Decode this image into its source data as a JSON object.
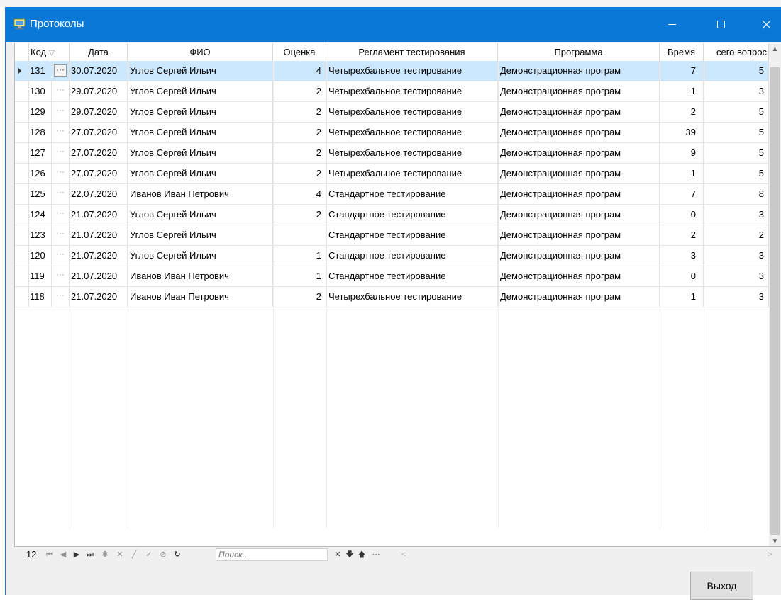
{
  "window": {
    "title": "Протоколы"
  },
  "columns": {
    "kod": "Код",
    "date": "Дата",
    "fio": "ФИО",
    "grade": "Оценка",
    "reglament": "Регламент тестирования",
    "program": "Программа",
    "time": "Время",
    "total": "сего вопрос"
  },
  "rows": [
    {
      "kod": "131",
      "date": "30.07.2020",
      "fio": "Углов Сергей Ильич",
      "grade": "4",
      "reglament": "Четырехбальное тестирование",
      "program": "Демонстрационная програм",
      "time": "7",
      "total": "5",
      "selected": true
    },
    {
      "kod": "130",
      "date": "29.07.2020",
      "fio": "Углов Сергей Ильич",
      "grade": "2",
      "reglament": "Четырехбальное тестирование",
      "program": "Демонстрационная програм",
      "time": "1",
      "total": "3"
    },
    {
      "kod": "129",
      "date": "29.07.2020",
      "fio": "Углов Сергей Ильич",
      "grade": "2",
      "reglament": "Четырехбальное тестирование",
      "program": "Демонстрационная програм",
      "time": "2",
      "total": "5"
    },
    {
      "kod": "128",
      "date": "27.07.2020",
      "fio": "Углов Сергей Ильич",
      "grade": "2",
      "reglament": "Четырехбальное тестирование",
      "program": "Демонстрационная програм",
      "time": "39",
      "total": "5"
    },
    {
      "kod": "127",
      "date": "27.07.2020",
      "fio": "Углов Сергей Ильич",
      "grade": "2",
      "reglament": "Четырехбальное тестирование",
      "program": "Демонстрационная програм",
      "time": "9",
      "total": "5"
    },
    {
      "kod": "126",
      "date": "27.07.2020",
      "fio": "Углов Сергей Ильич",
      "grade": "2",
      "reglament": "Четырехбальное тестирование",
      "program": "Демонстрационная програм",
      "time": "1",
      "total": "5"
    },
    {
      "kod": "125",
      "date": "22.07.2020",
      "fio": "Иванов Иван Петрович",
      "grade": "4",
      "reglament": "Стандартное тестирование",
      "program": "Демонстрационная програм",
      "time": "7",
      "total": "8"
    },
    {
      "kod": "124",
      "date": "21.07.2020",
      "fio": "Углов Сергей Ильич",
      "grade": "2",
      "reglament": "Стандартное тестирование",
      "program": "Демонстрационная програм",
      "time": "0",
      "total": "3"
    },
    {
      "kod": "123",
      "date": "21.07.2020",
      "fio": "Углов Сергей Ильич",
      "grade": "",
      "reglament": "Стандартное тестирование",
      "program": "Демонстрационная програм",
      "time": "2",
      "total": "2"
    },
    {
      "kod": "120",
      "date": "21.07.2020",
      "fio": "Углов Сергей Ильич",
      "grade": "1",
      "reglament": "Стандартное тестирование",
      "program": "Демонстрационная програм",
      "time": "3",
      "total": "3"
    },
    {
      "kod": "119",
      "date": "21.07.2020",
      "fio": "Иванов Иван Петрович",
      "grade": "1",
      "reglament": "Стандартное тестирование",
      "program": "Демонстрационная програм",
      "time": "0",
      "total": "3"
    },
    {
      "kod": "118",
      "date": "21.07.2020",
      "fio": "Иванов Иван Петрович",
      "grade": "2",
      "reglament": "Четырехбальное тестирование",
      "program": "Демонстрационная програм",
      "time": "1",
      "total": "3"
    }
  ],
  "navigator": {
    "record_count": "12",
    "search_placeholder": "Поиск..."
  },
  "buttons": {
    "exit": "Выход"
  },
  "colors": {
    "titlebar": "#0a78d7",
    "selected_row": "#cce8ff"
  }
}
